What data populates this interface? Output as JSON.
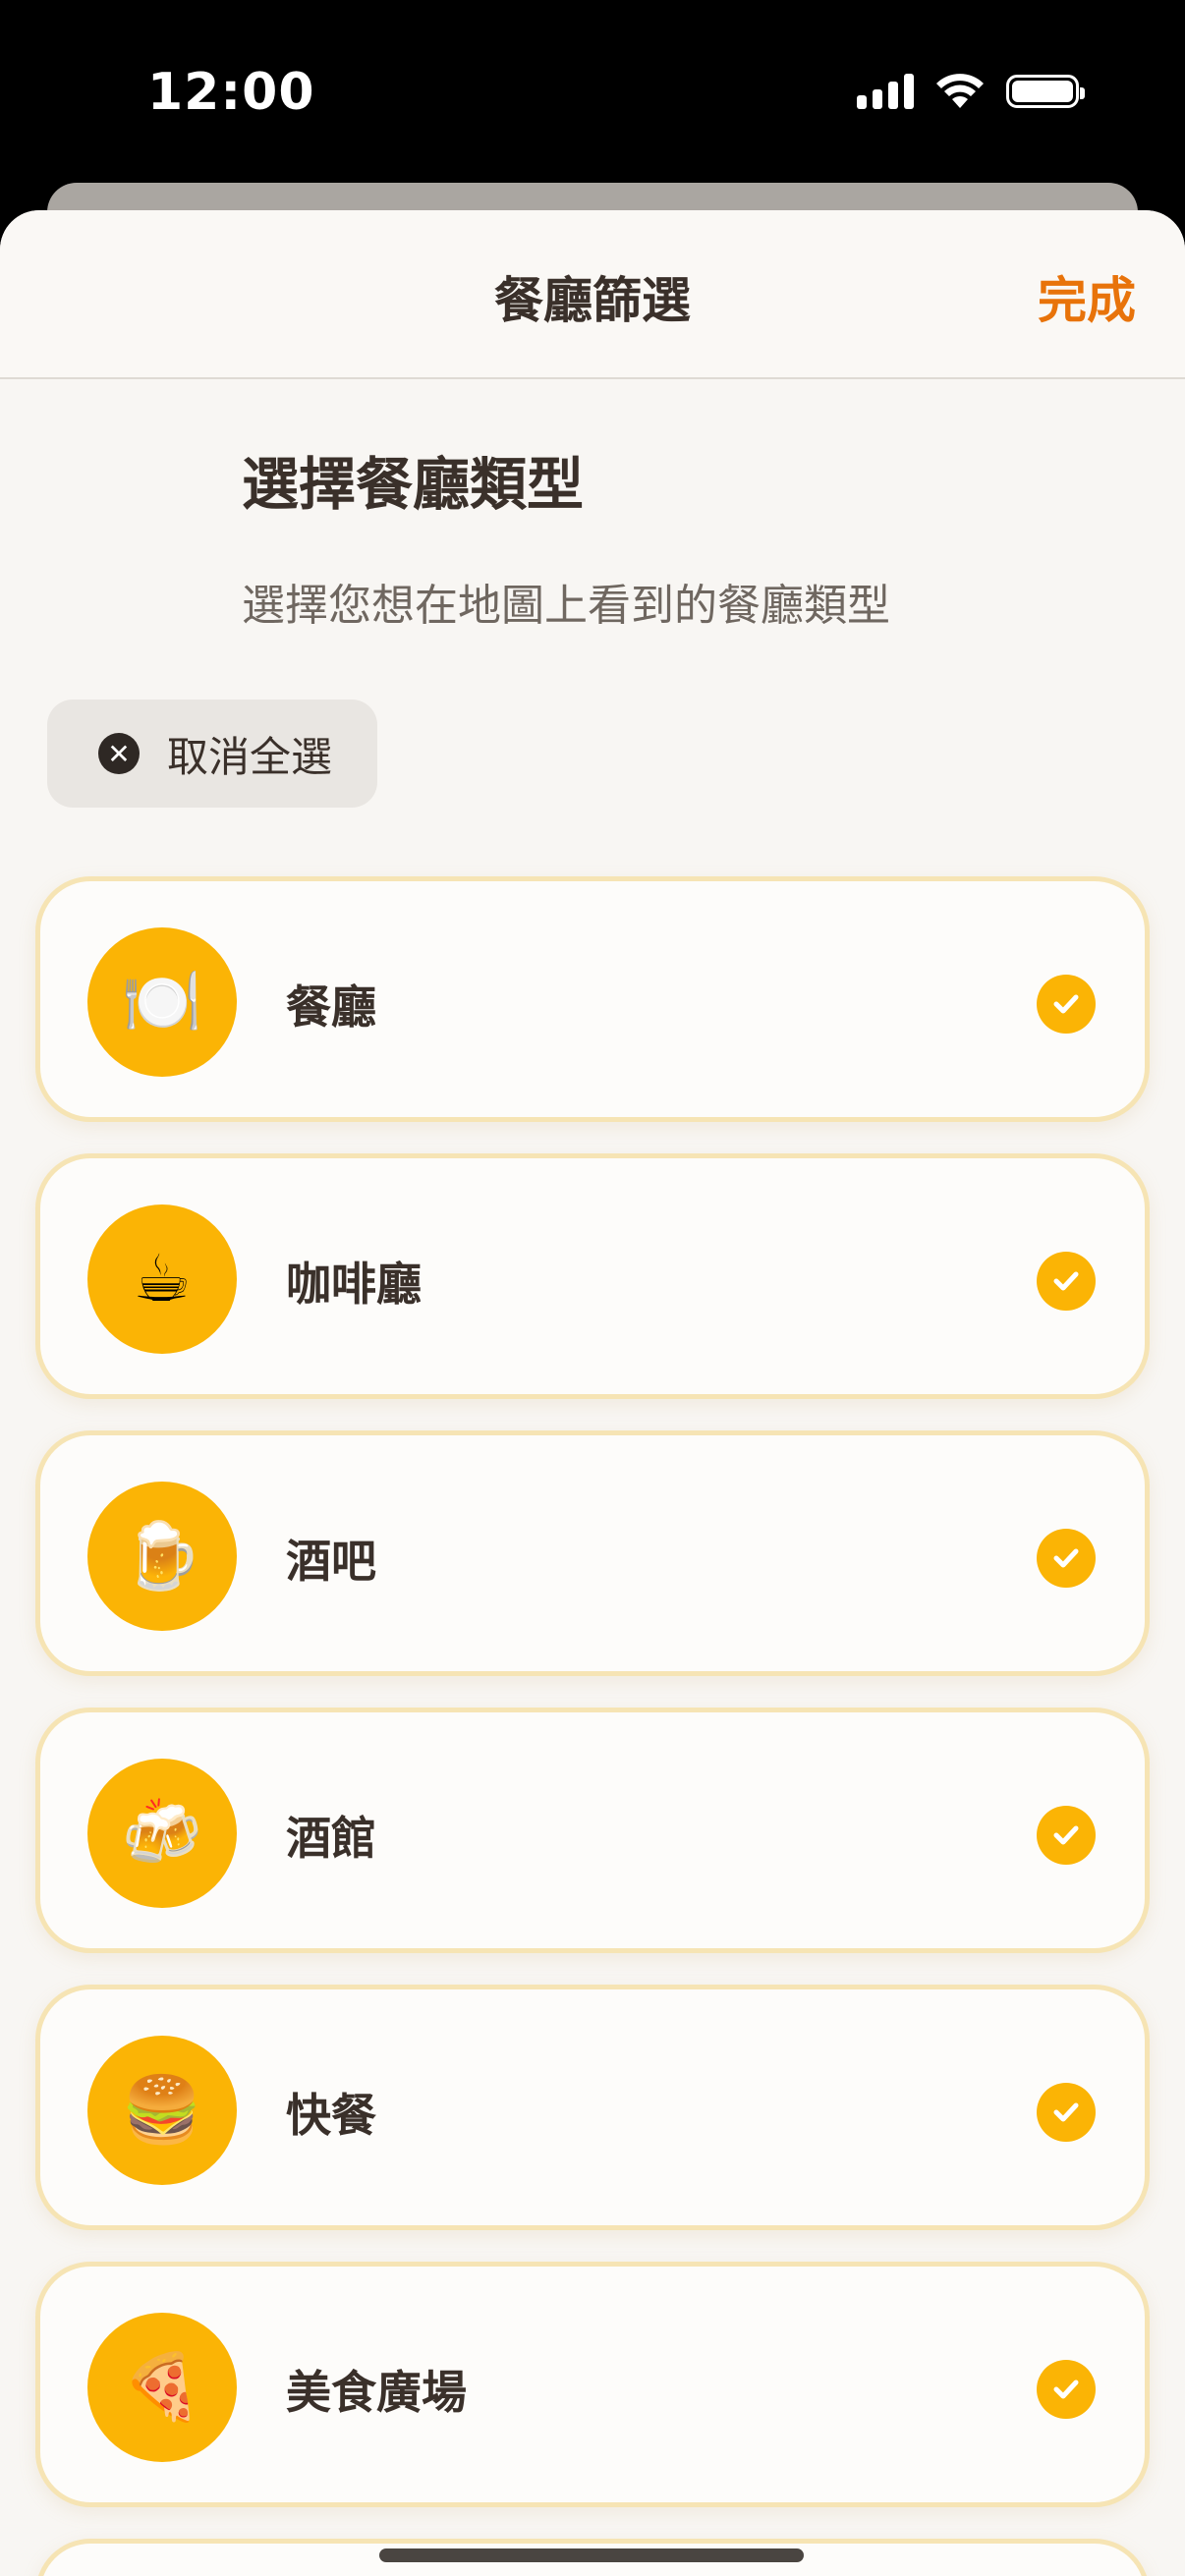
{
  "status_bar": {
    "time": "12:00"
  },
  "nav": {
    "title": "餐廳篩選",
    "done_label": "完成"
  },
  "header": {
    "title": "選擇餐廳類型",
    "subtitle": "選擇您想在地圖上看到的餐廳類型"
  },
  "deselect_all": {
    "label": "取消全選",
    "icon": "x-circle-icon"
  },
  "colors": {
    "accent": "#fbb405",
    "done_text": "#e8730a",
    "card_border": "#f6e4b4",
    "background": "#f8f6f3"
  },
  "categories": [
    {
      "label": "餐廳",
      "icon": "🍽️",
      "icon_name": "plate-cutlery-icon",
      "selected": true
    },
    {
      "label": "咖啡廳",
      "icon": "☕",
      "icon_name": "coffee-cup-icon",
      "selected": true
    },
    {
      "label": "酒吧",
      "icon": "🍺",
      "icon_name": "beer-mug-icon",
      "selected": true
    },
    {
      "label": "酒館",
      "icon": "🍻",
      "icon_name": "clinking-beers-icon",
      "selected": true
    },
    {
      "label": "快餐",
      "icon": "🍔",
      "icon_name": "burger-icon",
      "selected": true
    },
    {
      "label": "美食廣場",
      "icon": "🍕",
      "icon_name": "pizza-icon",
      "selected": true
    }
  ]
}
